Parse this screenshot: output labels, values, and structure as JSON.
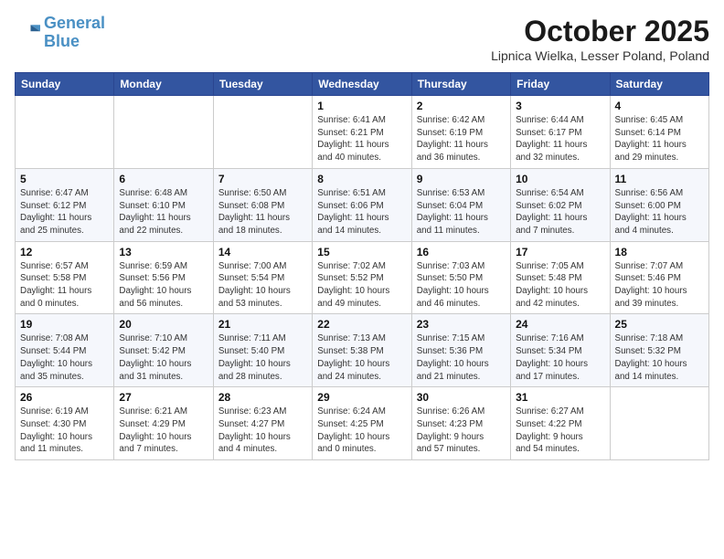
{
  "header": {
    "logo_line1": "General",
    "logo_line2": "Blue",
    "month": "October 2025",
    "location": "Lipnica Wielka, Lesser Poland, Poland"
  },
  "weekdays": [
    "Sunday",
    "Monday",
    "Tuesday",
    "Wednesday",
    "Thursday",
    "Friday",
    "Saturday"
  ],
  "weeks": [
    [
      {
        "day": "",
        "info": ""
      },
      {
        "day": "",
        "info": ""
      },
      {
        "day": "",
        "info": ""
      },
      {
        "day": "1",
        "info": "Sunrise: 6:41 AM\nSunset: 6:21 PM\nDaylight: 11 hours\nand 40 minutes."
      },
      {
        "day": "2",
        "info": "Sunrise: 6:42 AM\nSunset: 6:19 PM\nDaylight: 11 hours\nand 36 minutes."
      },
      {
        "day": "3",
        "info": "Sunrise: 6:44 AM\nSunset: 6:17 PM\nDaylight: 11 hours\nand 32 minutes."
      },
      {
        "day": "4",
        "info": "Sunrise: 6:45 AM\nSunset: 6:14 PM\nDaylight: 11 hours\nand 29 minutes."
      }
    ],
    [
      {
        "day": "5",
        "info": "Sunrise: 6:47 AM\nSunset: 6:12 PM\nDaylight: 11 hours\nand 25 minutes."
      },
      {
        "day": "6",
        "info": "Sunrise: 6:48 AM\nSunset: 6:10 PM\nDaylight: 11 hours\nand 22 minutes."
      },
      {
        "day": "7",
        "info": "Sunrise: 6:50 AM\nSunset: 6:08 PM\nDaylight: 11 hours\nand 18 minutes."
      },
      {
        "day": "8",
        "info": "Sunrise: 6:51 AM\nSunset: 6:06 PM\nDaylight: 11 hours\nand 14 minutes."
      },
      {
        "day": "9",
        "info": "Sunrise: 6:53 AM\nSunset: 6:04 PM\nDaylight: 11 hours\nand 11 minutes."
      },
      {
        "day": "10",
        "info": "Sunrise: 6:54 AM\nSunset: 6:02 PM\nDaylight: 11 hours\nand 7 minutes."
      },
      {
        "day": "11",
        "info": "Sunrise: 6:56 AM\nSunset: 6:00 PM\nDaylight: 11 hours\nand 4 minutes."
      }
    ],
    [
      {
        "day": "12",
        "info": "Sunrise: 6:57 AM\nSunset: 5:58 PM\nDaylight: 11 hours\nand 0 minutes."
      },
      {
        "day": "13",
        "info": "Sunrise: 6:59 AM\nSunset: 5:56 PM\nDaylight: 10 hours\nand 56 minutes."
      },
      {
        "day": "14",
        "info": "Sunrise: 7:00 AM\nSunset: 5:54 PM\nDaylight: 10 hours\nand 53 minutes."
      },
      {
        "day": "15",
        "info": "Sunrise: 7:02 AM\nSunset: 5:52 PM\nDaylight: 10 hours\nand 49 minutes."
      },
      {
        "day": "16",
        "info": "Sunrise: 7:03 AM\nSunset: 5:50 PM\nDaylight: 10 hours\nand 46 minutes."
      },
      {
        "day": "17",
        "info": "Sunrise: 7:05 AM\nSunset: 5:48 PM\nDaylight: 10 hours\nand 42 minutes."
      },
      {
        "day": "18",
        "info": "Sunrise: 7:07 AM\nSunset: 5:46 PM\nDaylight: 10 hours\nand 39 minutes."
      }
    ],
    [
      {
        "day": "19",
        "info": "Sunrise: 7:08 AM\nSunset: 5:44 PM\nDaylight: 10 hours\nand 35 minutes."
      },
      {
        "day": "20",
        "info": "Sunrise: 7:10 AM\nSunset: 5:42 PM\nDaylight: 10 hours\nand 31 minutes."
      },
      {
        "day": "21",
        "info": "Sunrise: 7:11 AM\nSunset: 5:40 PM\nDaylight: 10 hours\nand 28 minutes."
      },
      {
        "day": "22",
        "info": "Sunrise: 7:13 AM\nSunset: 5:38 PM\nDaylight: 10 hours\nand 24 minutes."
      },
      {
        "day": "23",
        "info": "Sunrise: 7:15 AM\nSunset: 5:36 PM\nDaylight: 10 hours\nand 21 minutes."
      },
      {
        "day": "24",
        "info": "Sunrise: 7:16 AM\nSunset: 5:34 PM\nDaylight: 10 hours\nand 17 minutes."
      },
      {
        "day": "25",
        "info": "Sunrise: 7:18 AM\nSunset: 5:32 PM\nDaylight: 10 hours\nand 14 minutes."
      }
    ],
    [
      {
        "day": "26",
        "info": "Sunrise: 6:19 AM\nSunset: 4:30 PM\nDaylight: 10 hours\nand 11 minutes."
      },
      {
        "day": "27",
        "info": "Sunrise: 6:21 AM\nSunset: 4:29 PM\nDaylight: 10 hours\nand 7 minutes."
      },
      {
        "day": "28",
        "info": "Sunrise: 6:23 AM\nSunset: 4:27 PM\nDaylight: 10 hours\nand 4 minutes."
      },
      {
        "day": "29",
        "info": "Sunrise: 6:24 AM\nSunset: 4:25 PM\nDaylight: 10 hours\nand 0 minutes."
      },
      {
        "day": "30",
        "info": "Sunrise: 6:26 AM\nSunset: 4:23 PM\nDaylight: 9 hours\nand 57 minutes."
      },
      {
        "day": "31",
        "info": "Sunrise: 6:27 AM\nSunset: 4:22 PM\nDaylight: 9 hours\nand 54 minutes."
      },
      {
        "day": "",
        "info": ""
      }
    ]
  ]
}
